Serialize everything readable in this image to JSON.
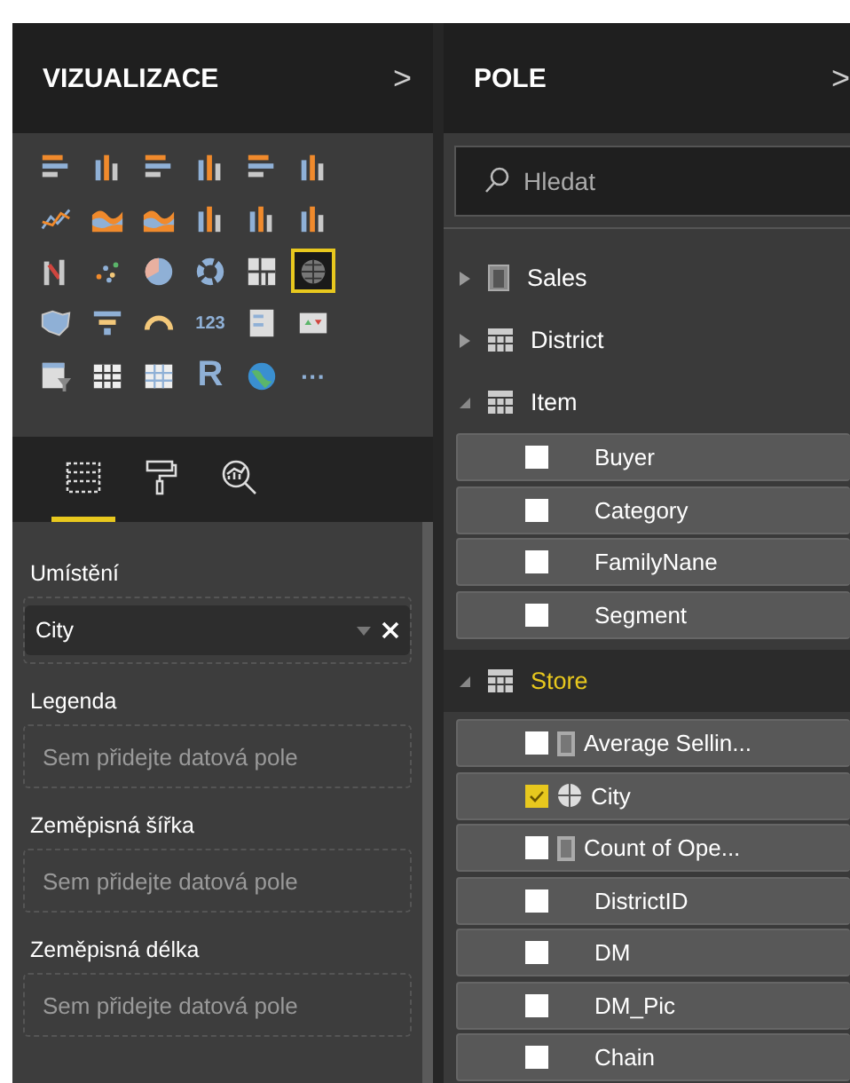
{
  "visualizations": {
    "title": "VIZUALIZACE",
    "collapse": ">",
    "visuals": [
      {
        "kind": "hbar",
        "selected": false
      },
      {
        "kind": "column",
        "selected": false
      },
      {
        "kind": "hbar",
        "selected": false
      },
      {
        "kind": "column",
        "selected": false
      },
      {
        "kind": "hbar",
        "selected": false
      },
      {
        "kind": "column",
        "selected": false
      },
      {
        "kind": "line",
        "selected": false
      },
      {
        "kind": "area",
        "selected": false
      },
      {
        "kind": "area",
        "selected": false
      },
      {
        "kind": "column",
        "selected": false
      },
      {
        "kind": "column",
        "selected": false
      },
      {
        "kind": "column",
        "selected": false
      },
      {
        "kind": "ribbon",
        "selected": false
      },
      {
        "kind": "scatter",
        "selected": false
      },
      {
        "kind": "pie",
        "selected": false
      },
      {
        "kind": "donut",
        "selected": false
      },
      {
        "kind": "treemap",
        "selected": false
      },
      {
        "kind": "map",
        "selected": true
      },
      {
        "kind": "filled-map",
        "selected": false
      },
      {
        "kind": "funnel",
        "selected": false
      },
      {
        "kind": "gauge",
        "selected": false
      },
      {
        "kind": "card",
        "text": "123",
        "selected": false
      },
      {
        "kind": "multirow",
        "selected": false
      },
      {
        "kind": "kpi",
        "selected": false
      },
      {
        "kind": "slicer",
        "selected": false
      },
      {
        "kind": "table",
        "selected": false
      },
      {
        "kind": "matrix",
        "selected": false
      },
      {
        "kind": "letter",
        "text": "R",
        "selected": false
      },
      {
        "kind": "globe",
        "selected": false
      },
      {
        "kind": "more",
        "text": "···",
        "selected": false
      }
    ],
    "tabs": [
      {
        "kind": "fields",
        "selected": true
      },
      {
        "kind": "format",
        "selected": false
      },
      {
        "kind": "analytics",
        "selected": false
      }
    ],
    "wells": [
      {
        "label": "Umístění",
        "value": "City"
      },
      {
        "label": "Legenda",
        "placeholder": "Sem přidejte datová pole"
      },
      {
        "label": "Zeměpisná šířka",
        "placeholder": "Sem přidejte datová pole"
      },
      {
        "label": "Zeměpisná délka",
        "placeholder": "Sem přidejte datová pole"
      }
    ]
  },
  "fields": {
    "title": "POLE",
    "collapse": ">",
    "search": {
      "placeholder": "Hledat"
    },
    "tables": [
      {
        "name": "Sales",
        "kind": "measures",
        "expanded": false,
        "selected": false
      },
      {
        "name": "District",
        "kind": "table",
        "expanded": false,
        "selected": false
      },
      {
        "name": "Item",
        "kind": "table",
        "expanded": true,
        "selected": false,
        "children": [
          {
            "name": "Buyer",
            "checked": false
          },
          {
            "name": "Category",
            "checked": false
          },
          {
            "name": "FamilyNane",
            "checked": false
          },
          {
            "name": "Segment",
            "checked": false
          }
        ]
      },
      {
        "name": "Store",
        "kind": "table",
        "expanded": true,
        "selected": true,
        "children": [
          {
            "name": "Average Sellin...",
            "checked": false,
            "kind": "measure"
          },
          {
            "name": "City",
            "checked": true,
            "kind": "geo"
          },
          {
            "name": "Count of Ope...",
            "checked": false,
            "kind": "measure"
          },
          {
            "name": "DistrictID",
            "checked": false
          },
          {
            "name": "DM",
            "checked": false
          },
          {
            "name": "DM_Pic",
            "checked": false
          },
          {
            "name": "Chain",
            "checked": false
          }
        ]
      }
    ]
  }
}
